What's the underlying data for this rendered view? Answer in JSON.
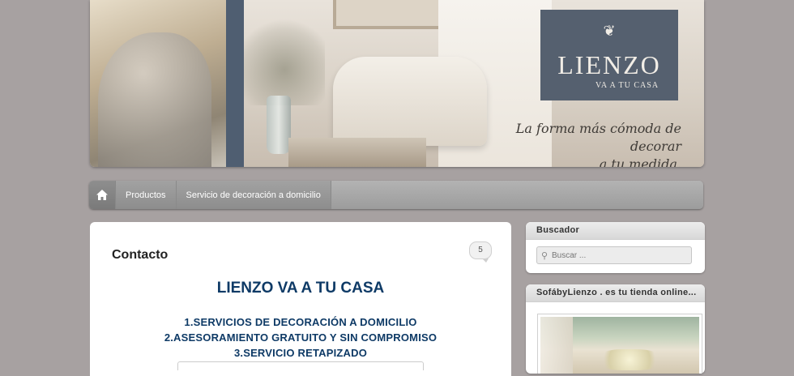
{
  "banner": {
    "logo_emblem": "❦",
    "brand": "LIENZO",
    "brand_tagline": "VA A TU CASA",
    "slogan_line1": "La forma más cómoda de decorar",
    "slogan_line2": "a tu medida."
  },
  "nav": {
    "home_icon": "home-icon",
    "items": [
      {
        "label": "Productos"
      },
      {
        "label": "Servicio de decoración a domicilio"
      }
    ]
  },
  "main": {
    "title": "Contacto",
    "comment_count": "5",
    "heading": "LIENZO VA A TU CASA",
    "services": [
      "1.SERVICIOS DE DECORACIÓN A DOMICILIO",
      "2.ASESORAMIENTO GRATUITO Y SIN COMPROMISO",
      "3.SERVICIO RETAPIZADO"
    ],
    "accent_color": "#0e3a66"
  },
  "sidebar": {
    "search": {
      "title": "Buscador",
      "placeholder": "Buscar ...",
      "icon": "search-icon"
    },
    "shop": {
      "title": "SofábyLienzo . es tu tienda online..."
    }
  }
}
